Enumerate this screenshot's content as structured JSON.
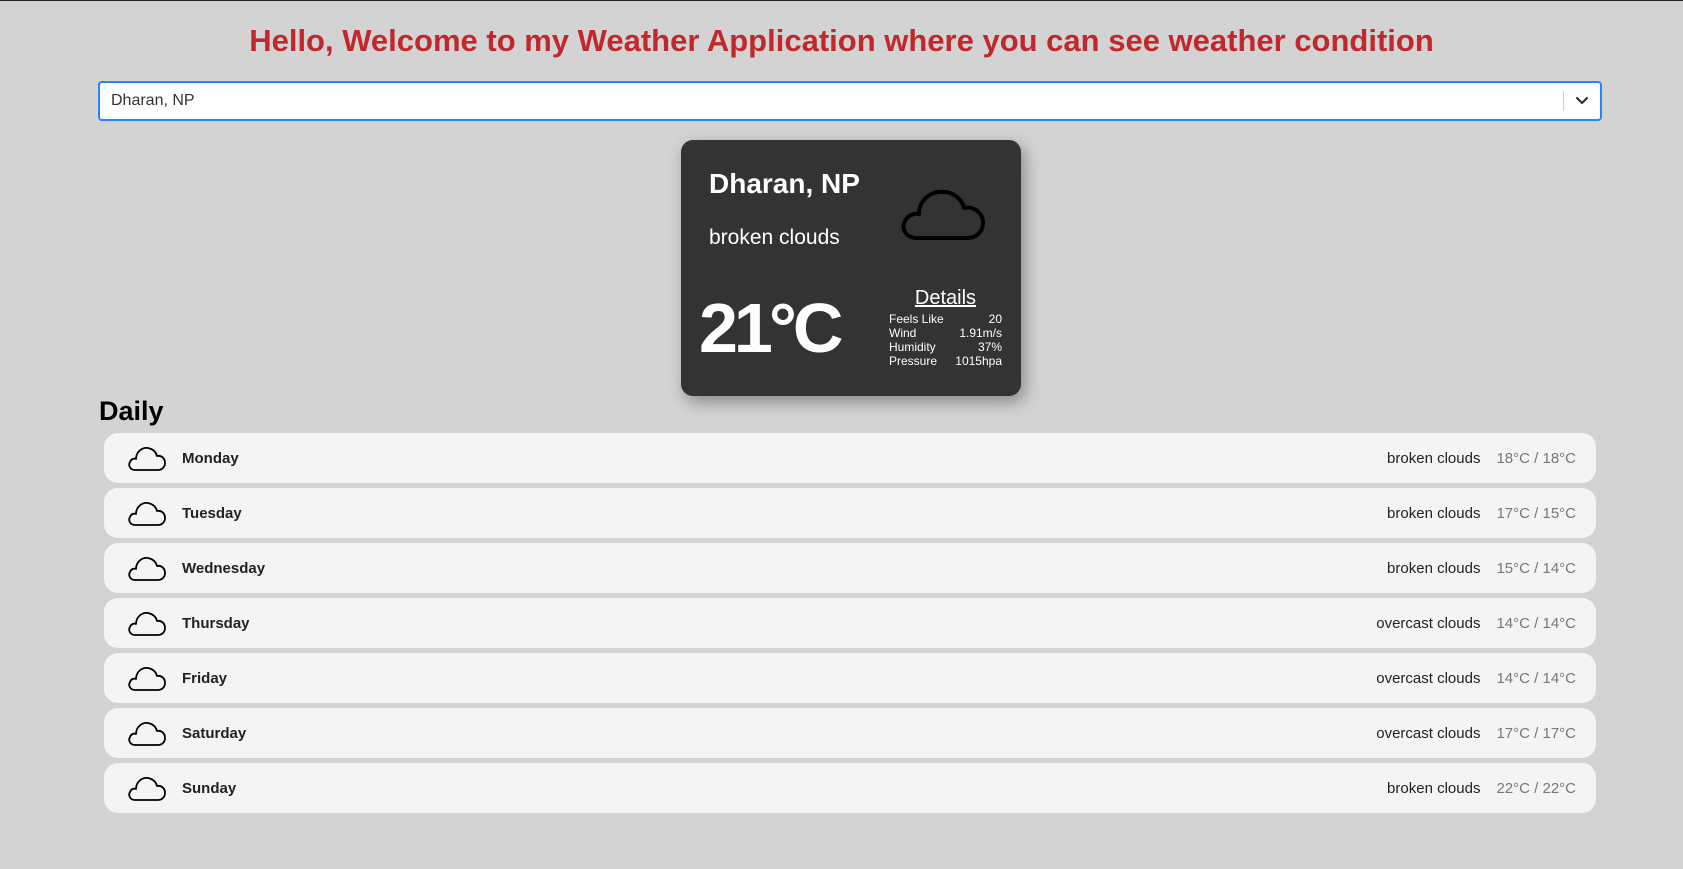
{
  "header": {
    "title": "Hello, Welcome to my Weather Application where you can see weather condition"
  },
  "search": {
    "value": "Dharan, NP"
  },
  "current": {
    "city": "Dharan, NP",
    "description": "broken clouds",
    "icon": "cloud-icon",
    "temperature": "21°C",
    "details": {
      "title": "Details",
      "rows": [
        {
          "label": "Feels Like",
          "value": "20"
        },
        {
          "label": "Wind",
          "value": "1.91m/s"
        },
        {
          "label": "Humidity",
          "value": "37%"
        },
        {
          "label": "Pressure",
          "value": "1015hpa"
        }
      ]
    }
  },
  "daily": {
    "title": "Daily",
    "days": [
      {
        "day": "Monday",
        "description": "broken clouds",
        "temp": "18°C / 18°C",
        "icon": "cloud-icon"
      },
      {
        "day": "Tuesday",
        "description": "broken clouds",
        "temp": "17°C / 15°C",
        "icon": "cloud-icon"
      },
      {
        "day": "Wednesday",
        "description": "broken clouds",
        "temp": "15°C / 14°C",
        "icon": "cloud-icon"
      },
      {
        "day": "Thursday",
        "description": "overcast clouds",
        "temp": "14°C / 14°C",
        "icon": "cloud-icon"
      },
      {
        "day": "Friday",
        "description": "overcast clouds",
        "temp": "14°C / 14°C",
        "icon": "cloud-icon"
      },
      {
        "day": "Saturday",
        "description": "overcast clouds",
        "temp": "17°C / 17°C",
        "icon": "cloud-icon"
      },
      {
        "day": "Sunday",
        "description": "broken clouds",
        "temp": "22°C / 22°C",
        "icon": "cloud-icon"
      }
    ]
  },
  "colors": {
    "title": "#c0282d",
    "background": "#d3d3d3",
    "card": "#333333",
    "focus_border": "#2684ff"
  }
}
